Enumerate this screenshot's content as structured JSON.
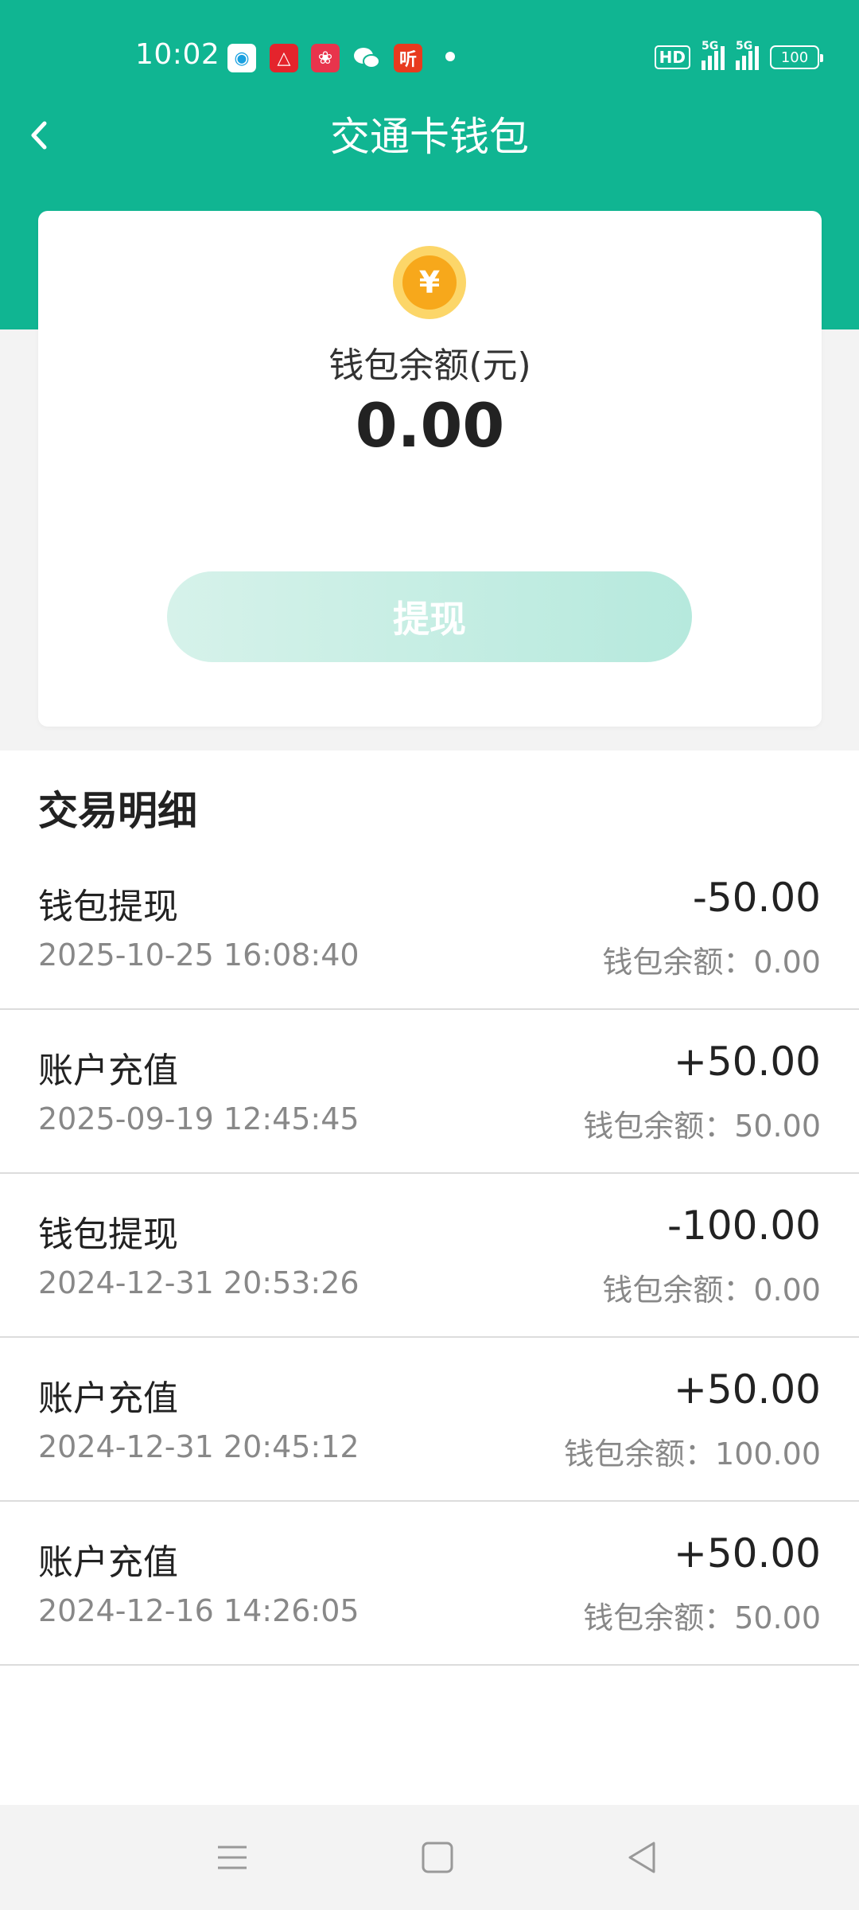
{
  "status_bar": {
    "time": "10:02",
    "app_icons": [
      {
        "name": "china-mobile-icon",
        "color": "#ffffff",
        "glyph": "◉",
        "fg": "#1aa0e0"
      },
      {
        "name": "app-red-icon",
        "color": "#e4242c",
        "glyph": "△",
        "fg": "#ffffff"
      },
      {
        "name": "app-pink-icon",
        "color": "#e8344c",
        "glyph": "❀",
        "fg": "#ffffff"
      },
      {
        "name": "wechat-icon",
        "color": "#10b592",
        "glyph": "",
        "fg": "#ffffff"
      },
      {
        "name": "ting-icon",
        "color": "#e83a1e",
        "glyph": "听",
        "fg": "#ffffff"
      }
    ],
    "hd_label": "HD",
    "network_1": "5G",
    "network_2": "5G",
    "battery": "100"
  },
  "header": {
    "title": "交通卡钱包"
  },
  "balance": {
    "label": "钱包余额(元)",
    "value": "0.00",
    "coin_symbol": "¥",
    "withdraw_label": "提现"
  },
  "transactions": {
    "title": "交易明细",
    "items": [
      {
        "type": "钱包提现",
        "time": "2025-10-25 16:08:40",
        "amount": "-50.00",
        "balance": "钱包余额：0.00"
      },
      {
        "type": "账户充值",
        "time": "2025-09-19 12:45:45",
        "amount": "+50.00",
        "balance": "钱包余额：50.00"
      },
      {
        "type": "钱包提现",
        "time": "2024-12-31 20:53:26",
        "amount": "-100.00",
        "balance": "钱包余额：0.00"
      },
      {
        "type": "账户充值",
        "time": "2024-12-31 20:45:12",
        "amount": "+50.00",
        "balance": "钱包余额：100.00"
      },
      {
        "type": "账户充值",
        "time": "2024-12-16 14:26:05",
        "amount": "+50.00",
        "balance": "钱包余额：50.00"
      }
    ]
  },
  "colors": {
    "brand": "#10b592",
    "coin_outer": "#fcd669",
    "coin_inner": "#f7a81b"
  }
}
